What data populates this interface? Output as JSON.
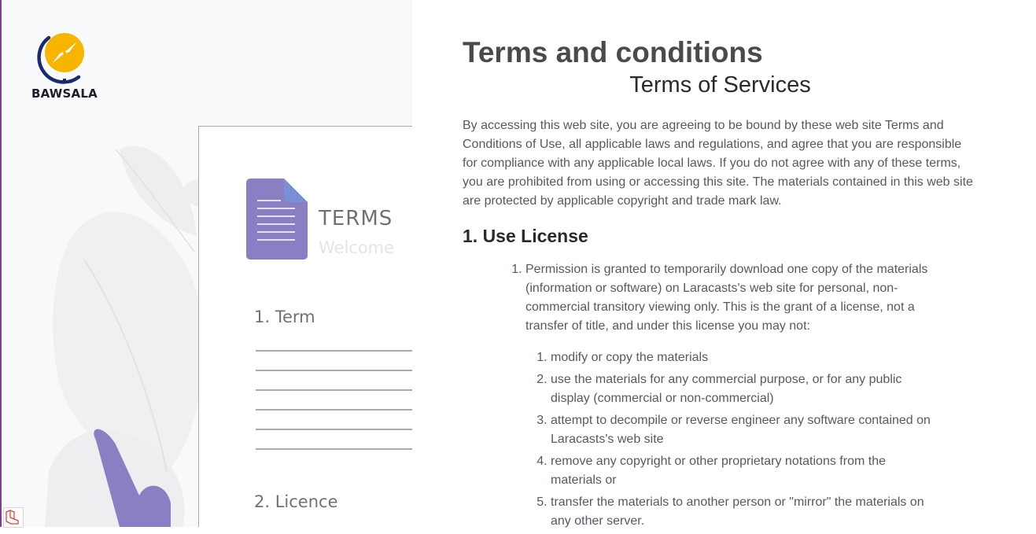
{
  "brand": {
    "name": "BAWSALA",
    "accent": "#f7b500",
    "navy": "#1b2a6e"
  },
  "illustration": {
    "doc_title": "TERMS",
    "doc_subtitle": "Welcome",
    "item1": "1. Term",
    "item2": "2. Licence",
    "colors": {
      "doc_icon": "#8b7fc4",
      "leaf_purple": "#8b7fc4",
      "leaf_grey": "#eceef0"
    }
  },
  "page": {
    "title": "Terms and conditions",
    "subtitle": "Terms of Services",
    "intro": "By accessing this web site, you are agreeing to be bound by these web site Terms and Conditions of Use, all applicable laws and regulations, and agree that you are responsible for compliance with any applicable local laws. If you do not agree with any of these terms, you are prohibited from using or accessing this site. The materials contained in this web site are protected by applicable copyright and trade mark law.",
    "section1": {
      "heading": "1. Use License",
      "item1": "Permission is granted to temporarily download one copy of the materials (information or software) on Laracasts's web site for personal, non-commercial transitory viewing only. This is the grant of a license, not a transfer of title, and under this license you may not:",
      "subitems": [
        "modify or copy the materials",
        "use the materials for any commercial purpose, or for any public display (commercial or non-commercial)",
        "attempt to decompile or reverse engineer any software contained on Laracasts's web site",
        "remove any copyright or other proprietary notations from the materials or",
        "transfer the materials to another person or \"mirror\" the materials on any other server."
      ]
    }
  },
  "debug_icon": "laravel-icon"
}
